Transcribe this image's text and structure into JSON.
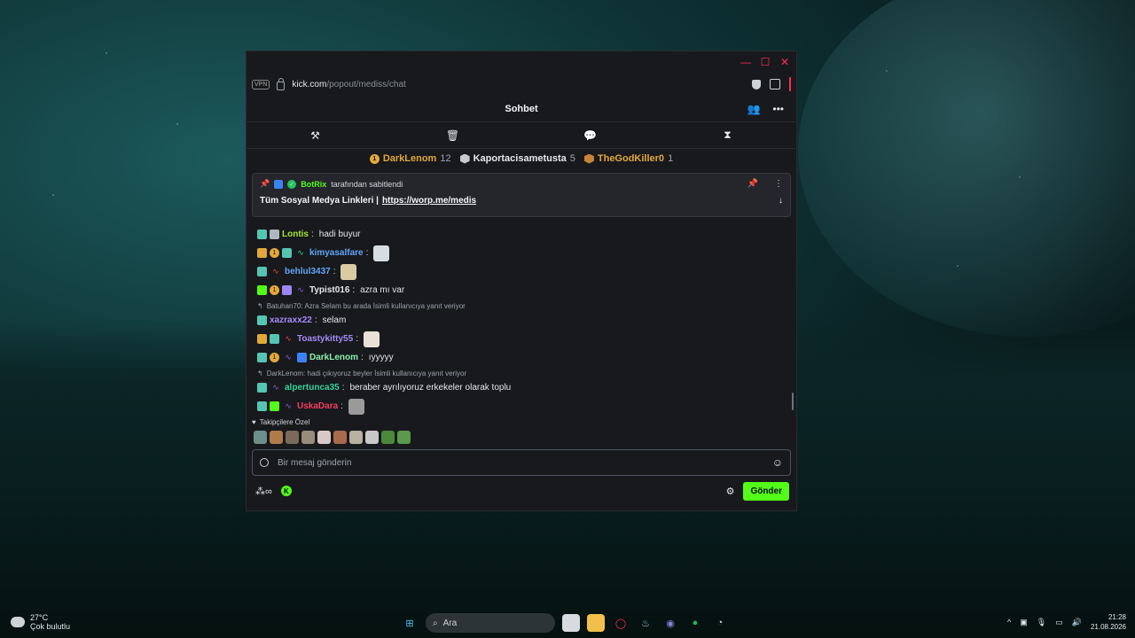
{
  "browser": {
    "vpn_label": "VPN",
    "url_host": "kick.com",
    "url_path": "/popout/mediss/chat"
  },
  "chat": {
    "title": "Sohbet",
    "leaderboard": [
      {
        "name": "DarkLenom",
        "count": "12",
        "color": "#e2a83a"
      },
      {
        "name": "Kaportacisametusta",
        "count": "5",
        "color": "#e5e7eb"
      },
      {
        "name": "TheGodKiller0",
        "count": "1",
        "color": "#e2a83a"
      }
    ],
    "pinned": {
      "pinned_by": "BotRix",
      "pinned_suffix": "tarafından sabitlendi",
      "text": "Tüm Sosyal Medya Linkleri |",
      "link": "https://worp.me/medis"
    },
    "messages": [
      {
        "user": "Lontis",
        "color": "#a3e635",
        "text": "hadi buyur"
      },
      {
        "user": "kimyasalfare",
        "color": "#60a5fa",
        "text": ""
      },
      {
        "user": "behlul3437",
        "color": "#60a5fa",
        "text": ""
      },
      {
        "user": "Typist016",
        "color": "#e5e7eb",
        "text": "azra mı var"
      },
      {
        "reply": "Batuhan70: Azra Selam bu arada İsimli kullanıcıya yanıt veriyor"
      },
      {
        "user": "xazraxx22",
        "color": "#a78bfa",
        "text": "selam"
      },
      {
        "user": "Toastykitty55",
        "color": "#a78bfa",
        "text": ""
      },
      {
        "user": "DarkLenom",
        "color": "#86efac",
        "text": "ıyyyyy"
      },
      {
        "reply": "DarkLenom: hadi çıkıyoruz beyler İsimli kullanıcıya yanıt veriyor"
      },
      {
        "user": "alpertunca35",
        "color": "#34d399",
        "text": "beraber ayrılıyoruz erkekeler olarak toplu"
      },
      {
        "user": "UskaDara",
        "color": "#f43f5e",
        "text": ""
      }
    ],
    "followers_only_label": "Takipçilere Özel",
    "input_placeholder": "Bir mesaj gönderin",
    "send_label": "Gönder",
    "accent": "#53fc18"
  },
  "taskbar": {
    "weather_temp": "27°C",
    "weather_desc": "Çok bulutlu",
    "search_label": "Ara",
    "time": "21:28",
    "date": "21.08.2026"
  }
}
